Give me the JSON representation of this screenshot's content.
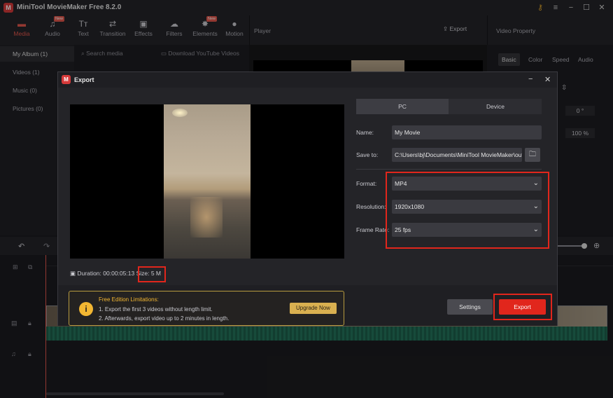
{
  "window": {
    "title": "MiniTool MovieMaker Free 8.2.0",
    "logo": "M"
  },
  "toolbar": {
    "tabs": [
      {
        "label": "Media",
        "icon": "folder-icon"
      },
      {
        "label": "Audio",
        "icon": "music-note-icon",
        "badge": "New"
      },
      {
        "label": "Text",
        "icon": "text-icon"
      },
      {
        "label": "Transition",
        "icon": "transition-icon"
      },
      {
        "label": "Effects",
        "icon": "effects-icon"
      },
      {
        "label": "Filters",
        "icon": "filters-icon"
      },
      {
        "label": "Elements",
        "icon": "elements-icon",
        "badge": "New"
      },
      {
        "label": "Motion",
        "icon": "motion-icon"
      }
    ]
  },
  "player": {
    "title": "Player",
    "export_label": "Export"
  },
  "video_property": {
    "title": "Video Property",
    "tabs": [
      "Basic",
      "Color",
      "Speed",
      "Audio"
    ],
    "rotation": "0 °",
    "scale": "100 %"
  },
  "library": {
    "items": [
      "My Album (1)",
      "Videos (1)",
      "Music (0)",
      "Pictures (0)"
    ],
    "search_placeholder": "Search media",
    "youtube_label": "Download YouTube Videos"
  },
  "dialog": {
    "logo": "M",
    "title": "Export",
    "tabs": [
      "PC",
      "Device"
    ],
    "name_label": "Name:",
    "name_value": "My Movie",
    "save_label": "Save to:",
    "save_value": "C:\\Users\\bj\\Documents\\MiniTool MovieMaker\\outp",
    "format_label": "Format:",
    "format_value": "MP4",
    "resolution_label": "Resolution:",
    "resolution_value": "1920x1080",
    "framerate_label": "Frame Rate:",
    "framerate_value": "25 fps",
    "duration_label": "Duration:",
    "duration_value": "00:00:05:13",
    "size_label": "Size:",
    "size_value": "5 M",
    "notice_title": "Free Edition Limitations:",
    "notice_line1": "1. Export the first 3 videos without length limit.",
    "notice_line2": "2. Afterwards, export video up to 2 minutes in length.",
    "upgrade_label": "Upgrade Now",
    "settings_label": "Settings",
    "export_label": "Export"
  },
  "colors": {
    "accent": "#e2574c",
    "highlight": "#e1261c",
    "notice": "#f2b632"
  }
}
